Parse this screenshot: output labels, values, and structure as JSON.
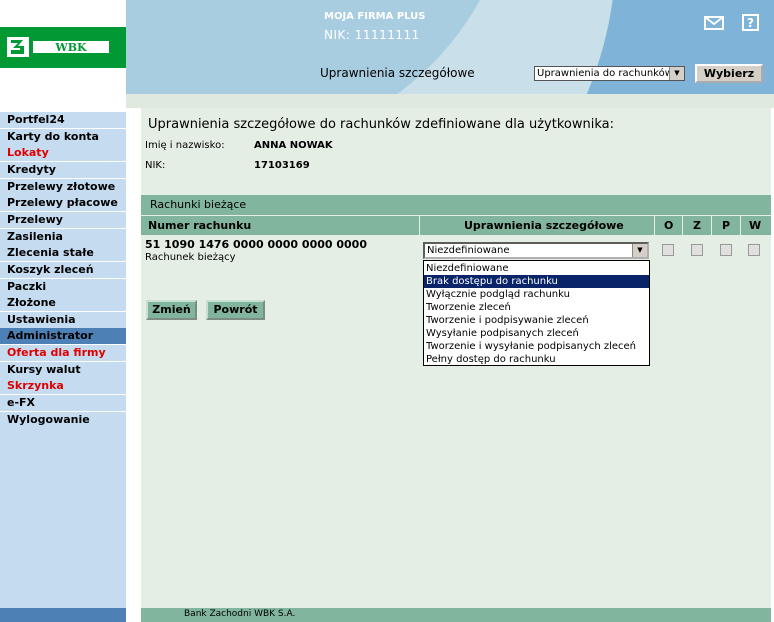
{
  "header": {
    "firm_name": "MOJA FIRMA PLUS",
    "nik": "NIK: 11111111",
    "section_title": "Uprawnienia szczegółowe",
    "select_value": "Uprawnienia do rachunków",
    "select_button": "Wybierz",
    "icons": [
      "mail-icon",
      "help-icon"
    ]
  },
  "sidebar": {
    "items": [
      {
        "label": "Portfel24"
      },
      {
        "label": "Karty do konta"
      },
      {
        "label": "Lokaty"
      },
      {
        "label": "Kredyty"
      },
      {
        "label": "Przelewy złotowe"
      },
      {
        "label": "Przelewy płacowe"
      },
      {
        "label": "Przelewy walutowe"
      },
      {
        "label": "Zasilenia telefonów"
      },
      {
        "label": "Zlecenia stałe"
      },
      {
        "label": "Koszyk zleceń"
      },
      {
        "label": "Paczki"
      },
      {
        "label": "Złożone dyspozycje"
      },
      {
        "label": "Ustawienia"
      },
      {
        "label": "Administrator"
      },
      {
        "label": "Oferta dla firmy"
      },
      {
        "label": "Kursy walut"
      },
      {
        "label": "Skrzynka odbiorcza"
      },
      {
        "label": "e-FX"
      },
      {
        "label": "Wylogowanie"
      }
    ]
  },
  "main": {
    "title": "Uprawnienia szczegółowe do rachunków zdefiniowane dla użytkownika:",
    "name_label": "Imię i nazwisko:",
    "name_value": "ANNA NOWAK",
    "nik_label": "NIK:",
    "nik_value": "17103169",
    "section": "Rachunki bieżące",
    "columns": [
      "Numer rachunku",
      "Uprawnienia szczegółowe",
      "O",
      "Z",
      "P",
      "W"
    ],
    "account_number": "51 1090 1476 0000 0000 0000 0000",
    "account_type": "Rachunek bieżący",
    "permission_value": "Niezdefiniowane",
    "options": [
      "Niezdefiniowane",
      "Brak dostępu do rachunku",
      "Wyłącznie podgląd rachunku",
      "Tworzenie zleceń",
      "Tworzenie i podpisywanie zleceń",
      "Wysyłanie podpisanych zleceń",
      "Tworzenie i wysyłanie podpisanych zleceń",
      "Pełny dostęp do rachunku"
    ],
    "selected_option_index": 1,
    "change_button": "Zmień",
    "back_button": "Powrót"
  },
  "footer": {
    "text": "Bank Zachodni WBK S.A."
  },
  "colors": {
    "brand_green": "#009933",
    "header_blue": "#7fb4d8",
    "sidebar_item": "#c5dbf0",
    "sidebar_active": "#4d80b5",
    "table_header": "#82b59e",
    "content_bg": "#e5eee5",
    "alert_red": "#e00000"
  },
  "brand": {
    "logo_text": "WBK"
  }
}
